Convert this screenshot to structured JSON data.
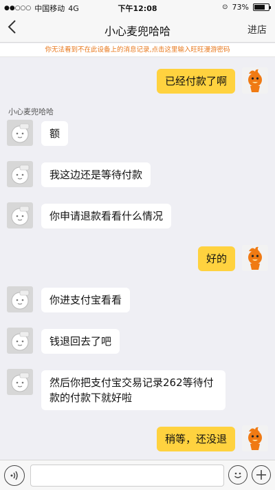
{
  "status_bar": {
    "signal_dots": "●●○○○",
    "carrier": "中国移动",
    "network": "4G",
    "time": "下午12:08",
    "battery_percent": "73%",
    "battery_level": 0.73
  },
  "nav": {
    "back_icon": "chevron-left",
    "title": "小心麦兜哈哈",
    "action": "进店"
  },
  "notice": "你无法看到不在此设备上的消息记录,点击这里输入旺旺漫游密码",
  "sender_name": "小心麦兜哈哈",
  "messages": [
    {
      "side": "right",
      "text": "已经付款了啊"
    },
    {
      "side": "left",
      "text": "额"
    },
    {
      "side": "left",
      "text": "我这边还是等待付款"
    },
    {
      "side": "left",
      "text": "你申请退款看看什么情况"
    },
    {
      "side": "right",
      "text": "好的"
    },
    {
      "side": "left",
      "text": "你进支付宝看看"
    },
    {
      "side": "left",
      "text": "钱退回去了吧"
    },
    {
      "side": "left",
      "text": "然后你把支付宝交易记录262等待付款的付款下就好啦"
    },
    {
      "side": "right",
      "text": "稍等，还没退"
    }
  ],
  "input_bar": {
    "voice_icon": "voice-icon",
    "emoji_icon": "emoji-icon",
    "plus_icon": "plus-icon",
    "placeholder": ""
  },
  "colors": {
    "accent": "#ffd23f",
    "notice": "#e8771a",
    "background": "#efeff4"
  }
}
